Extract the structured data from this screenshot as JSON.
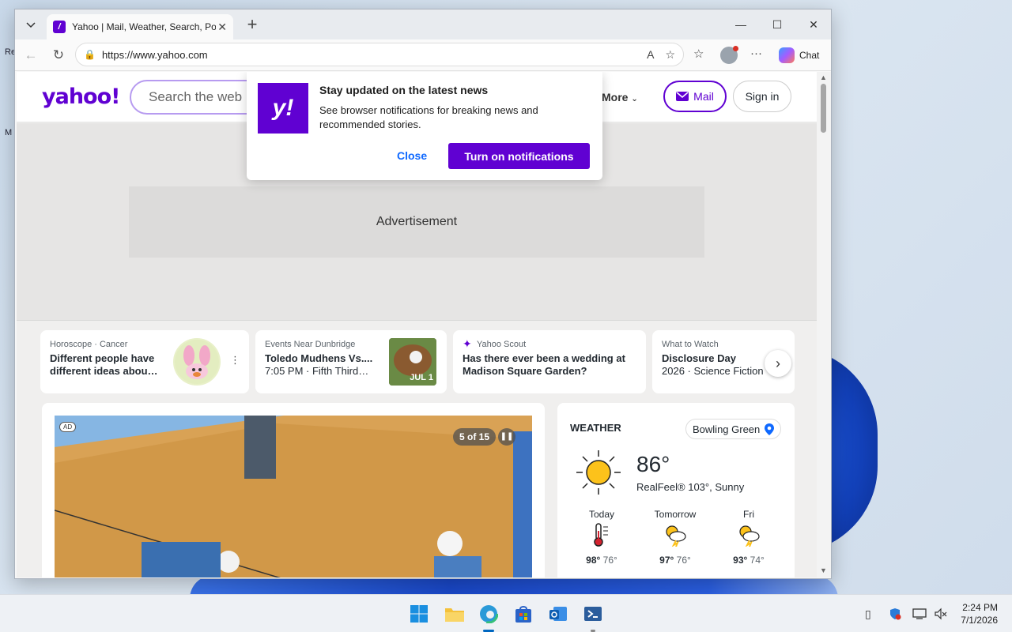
{
  "desktop": {
    "fragment_1": "Re",
    "fragment_2": "M"
  },
  "browser": {
    "tab_title": "Yahoo | Mail, Weather, Search, Politics",
    "url": "https://www.yahoo.com",
    "chat_label": "Chat",
    "new_tab_symbol": "+",
    "close_tab_symbol": "✕"
  },
  "yahoo": {
    "logo": "yahoo!",
    "search_placeholder": "Search the web",
    "more_label": "More",
    "mail_label": "Mail",
    "signin_label": "Sign in",
    "ad_label": "Advertisement"
  },
  "notification": {
    "logo": "y!",
    "title": "Stay updated on the latest news",
    "body": "See browser notifications for breaking news and recommended stories.",
    "close_label": "Close",
    "enable_label": "Turn on notifications"
  },
  "strip_cards": [
    {
      "kicker": "Horoscope · Cancer",
      "title": "Different people have different ideas abou…"
    },
    {
      "kicker": "Events Near Dunbridge",
      "title": "Toledo Mudhens Vs....",
      "sub": "7:05 PM · Fifth Third…",
      "badge": "JUL 1"
    },
    {
      "kicker": "Yahoo Scout",
      "title": "Has there ever been a wedding at Madison Square Garden?"
    },
    {
      "kicker": "What to Watch",
      "title": "Disclosure Day",
      "sub": "2026 · Science Fiction"
    }
  ],
  "hero": {
    "ad_tag": "AD",
    "counter": "5 of 15"
  },
  "weather": {
    "title": "WEATHER",
    "location": "Bowling Green",
    "temp": "86°",
    "realfeel": "RealFeel® 103°, Sunny",
    "forecast": [
      {
        "day": "Today",
        "high": "98°",
        "low": "76°",
        "icon": "thermometer-icon"
      },
      {
        "day": "Tomorrow",
        "high": "97°",
        "low": "76°",
        "icon": "thunderstorm-sun-icon"
      },
      {
        "day": "Fri",
        "high": "93°",
        "low": "74°",
        "icon": "thunderstorm-sun-icon"
      }
    ]
  },
  "taskbar": {
    "time": "2:24 PM",
    "date": "7/1/2026"
  },
  "colors": {
    "yahoo_purple": "#6001d2",
    "link_blue": "#0f69ff",
    "sun_yellow": "#fcc21b"
  }
}
